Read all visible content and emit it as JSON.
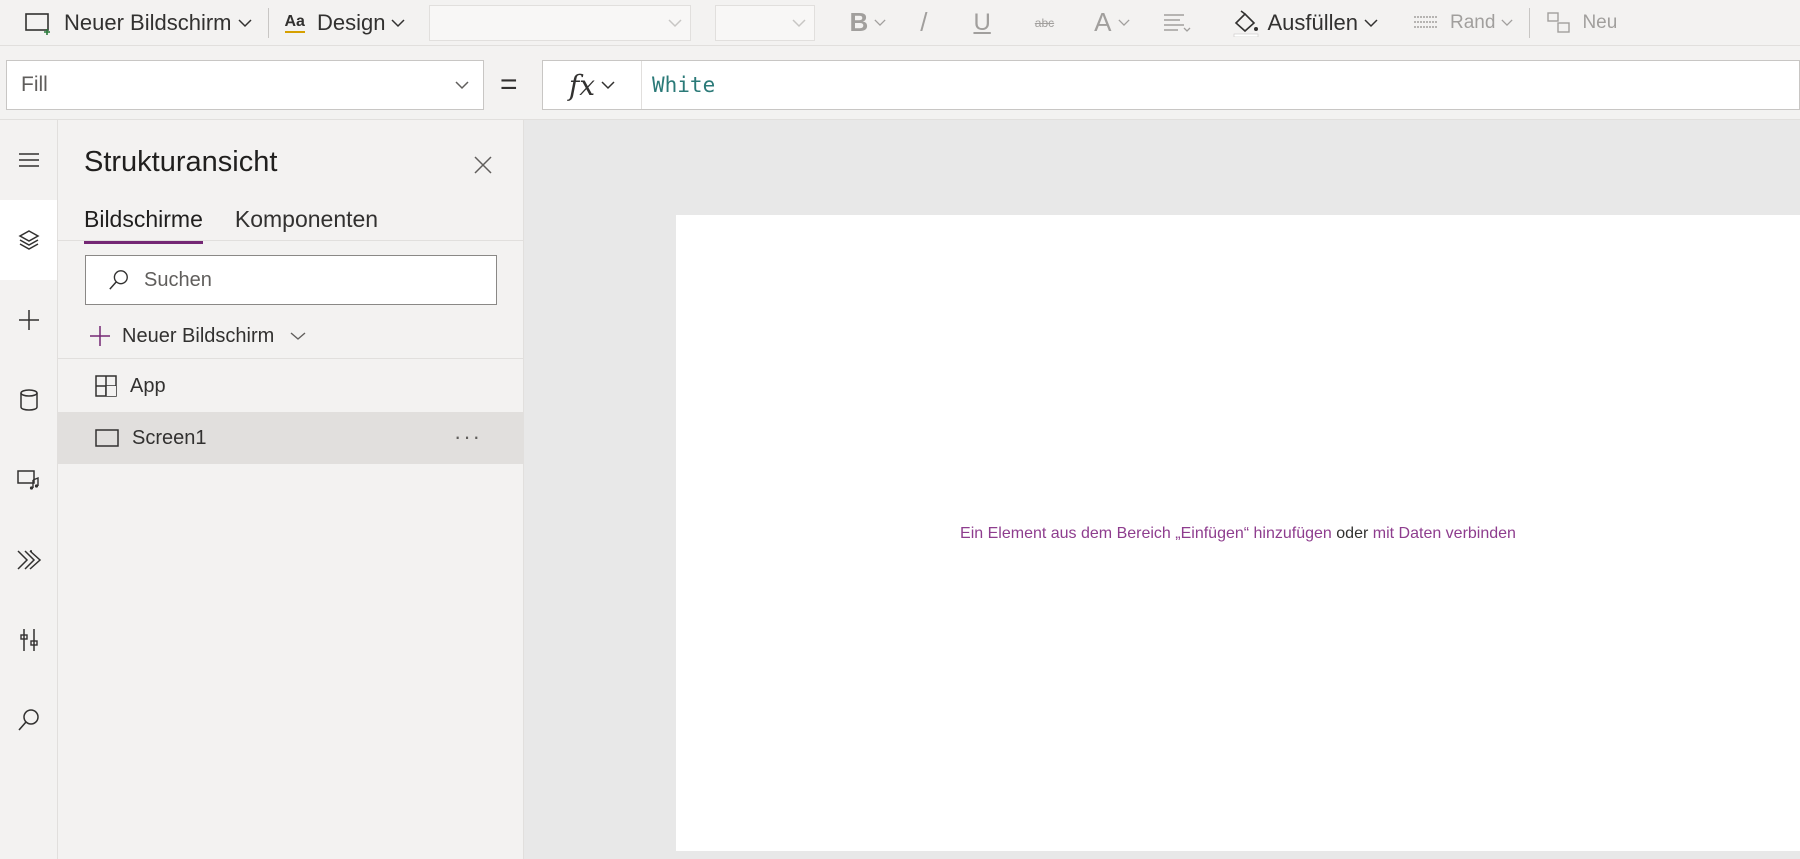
{
  "toolbar": {
    "new_screen_label": "Neuer Bildschirm",
    "design_label": "Design",
    "design_icon_text": "Aa",
    "bold_label": "B",
    "italic_label": "/",
    "underline_label": "U",
    "strike_label": "abc",
    "font_color_label": "A",
    "fill_label": "Ausfüllen",
    "border_label": "Rand",
    "new_label": "Neu"
  },
  "formula_bar": {
    "property": "Fill",
    "equals": "=",
    "fx_label": "fx",
    "value": "White"
  },
  "rail": {
    "icons": [
      "menu-icon",
      "tree-view-icon",
      "insert-icon",
      "data-icon",
      "media-icon",
      "power-automate-icon",
      "advanced-tools-icon",
      "search-icon"
    ],
    "active": "tree-view-icon"
  },
  "tree_pane": {
    "title": "Strukturansicht",
    "tabs": [
      {
        "label": "Bildschirme",
        "active": true
      },
      {
        "label": "Komponenten",
        "active": false
      }
    ],
    "search_placeholder": "Suchen",
    "new_screen_label": "Neuer Bildschirm",
    "items": [
      {
        "label": "App",
        "icon": "app-icon",
        "selected": false
      },
      {
        "label": "Screen1",
        "icon": "screen-icon",
        "selected": true,
        "more": "···"
      }
    ]
  },
  "canvas": {
    "hint_part1": "Ein Element aus dem Bereich „Einfügen“ hinzufügen",
    "hint_or": "oder",
    "hint_part2": "mit Daten verbinden"
  },
  "colors": {
    "accent": "#742774",
    "hint_link": "#8e3d8e",
    "formula_value": "#2b7a78"
  }
}
